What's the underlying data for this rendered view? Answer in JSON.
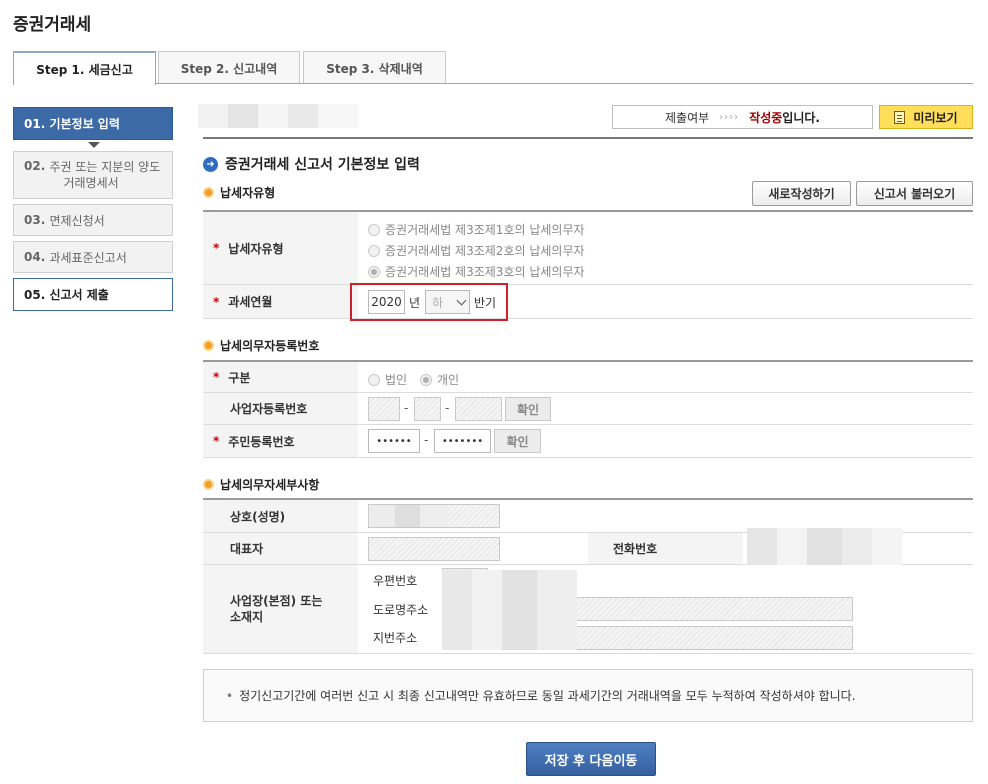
{
  "page": {
    "title": "증권거래세"
  },
  "tabs": [
    {
      "label": "Step 1. 세금신고",
      "active": true
    },
    {
      "label": "Step 2. 신고내역",
      "active": false
    },
    {
      "label": "Step 3. 삭제내역",
      "active": false
    }
  ],
  "sidebar": {
    "items": [
      {
        "num": "01.",
        "label": "기본정보 입력",
        "state": "active"
      },
      {
        "num": "02.",
        "label": "주권 또는 지분의 양도",
        "label2": "거래명세서",
        "state": "normal"
      },
      {
        "num": "03.",
        "label": "면제신청서",
        "state": "normal"
      },
      {
        "num": "04.",
        "label": "과세표준신고서",
        "state": "normal"
      },
      {
        "num": "05.",
        "label": "신고서 제출",
        "state": "selected"
      }
    ]
  },
  "status": {
    "label": "제출여부",
    "arrows": "››››",
    "state": "작성중",
    "suffix": "입니다."
  },
  "preview_button": "미리보기",
  "main_title": "증권거래세 신고서 기본정보 입력",
  "section1": {
    "title": "납세자유형",
    "new_button": "새로작성하기",
    "load_button": "신고서 불러오기",
    "taxpayer_type_label": "납세자유형",
    "options": [
      {
        "label": "증권거래세법 제3조제1호의 납세의무자",
        "checked": false
      },
      {
        "label": "증권거래세법 제3조제2호의 납세의무자",
        "checked": false
      },
      {
        "label": "증권거래세법 제3조제3호의 납세의무자",
        "checked": true
      }
    ],
    "period_label": "과세연월",
    "year": "2020",
    "year_unit": "년",
    "half_selected": "하",
    "half_unit": "반기"
  },
  "section2": {
    "title": "납세의무자등록번호",
    "type_label": "구분",
    "type_options": [
      {
        "label": "법인",
        "checked": false
      },
      {
        "label": "개인",
        "checked": true
      }
    ],
    "biz_no_label": "사업자등록번호",
    "confirm": "확인",
    "rrn_label": "주민등록번호",
    "rrn_front": "••••••",
    "rrn_back": "•••••••",
    "dash": "-"
  },
  "section3": {
    "title": "납세의무자세부사항",
    "name_label": "상호(성명)",
    "rep_label": "대표자",
    "phone_label": "전화번호",
    "addr_label_1": "사업장(본점) 또는",
    "addr_label_2": "소재지",
    "zip_label": "우편번호",
    "road_label": "도로명주소",
    "lot_label": "지번주소"
  },
  "notice": {
    "bullet": "•",
    "text": "정기신고기간에 여러번 신고 시 최종 신고내역만 유효하므로 동일 과세기간의 거래내역을 모두 누적하여 작성하셔야 합니다."
  },
  "save_button": "저장 후 다음이동",
  "colors": {
    "primary": "#3c6aa6",
    "accent_red": "#a40000",
    "preview_yellow": "#ffde5a",
    "highlight": "#d0202a"
  }
}
